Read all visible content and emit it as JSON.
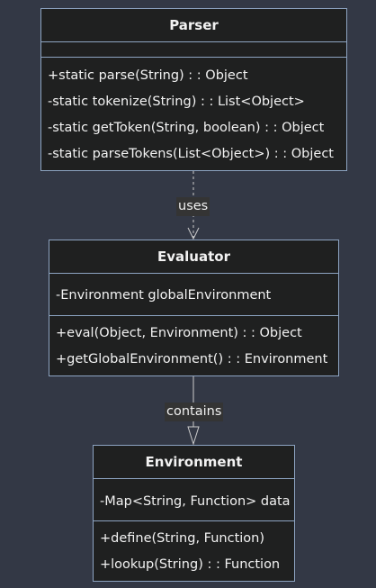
{
  "classes": {
    "parser": {
      "name": "Parser",
      "attributes": [],
      "methods": [
        "+static parse(String) : : Object",
        "-static tokenize(String) : : List<Object>",
        "-static getToken(String, boolean) : : Object",
        "-static parseTokens(List<Object>) : : Object"
      ]
    },
    "evaluator": {
      "name": "Evaluator",
      "attributes": [
        "-Environment globalEnvironment"
      ],
      "methods": [
        "+eval(Object, Environment) : : Object",
        "+getGlobalEnvironment() : : Environment"
      ]
    },
    "environment": {
      "name": "Environment",
      "attributes": [
        "-Map<String, Function> data"
      ],
      "methods": [
        "+define(String, Function)",
        "+lookup(String) : : Function"
      ]
    }
  },
  "relations": [
    {
      "from": "Parser",
      "to": "Evaluator",
      "label": "uses",
      "style": "dependency"
    },
    {
      "from": "Evaluator",
      "to": "Environment",
      "label": "contains",
      "style": "association"
    }
  ],
  "colors": {
    "background": "#333845",
    "box_fill": "#1f2020",
    "box_border": "#8da4c2",
    "text": "#f2f2f2",
    "line": "#cccccc",
    "label_bg": "#343434"
  }
}
